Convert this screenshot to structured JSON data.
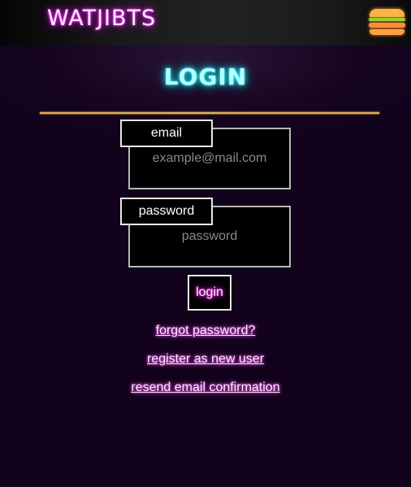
{
  "header": {
    "brand": "WATJIBTS",
    "menu_icon": "hamburger-menu-icon"
  },
  "main": {
    "title": "LOGIN",
    "email": {
      "label": "email",
      "placeholder": "example@mail.com",
      "value": ""
    },
    "password": {
      "label": "password",
      "placeholder": "password",
      "value": ""
    },
    "login_label": "login",
    "links": {
      "forgot": "forgot password?",
      "register": "register as new user",
      "resend": "resend email confirmation"
    }
  },
  "colors": {
    "background": "#13021f",
    "neon_pink": "#ff4dff",
    "neon_cyan": "#10d8e0",
    "divider": "#e8b04a",
    "burger_bun": "#ffb347",
    "burger_lettuce": "#9acd32",
    "burger_patty": "#ff8c3a"
  }
}
